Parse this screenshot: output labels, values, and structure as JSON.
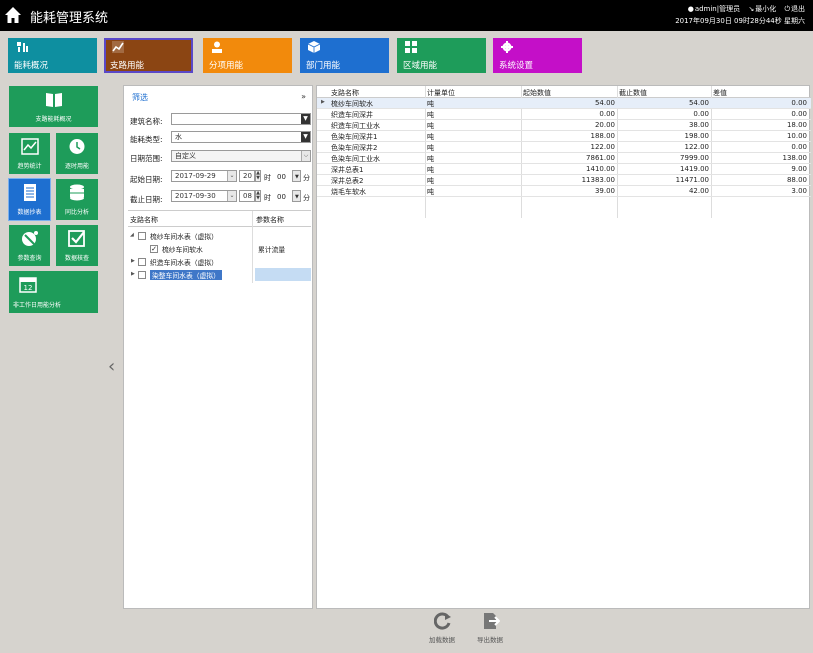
{
  "window": {
    "title": "能耗管理系统"
  },
  "header": {
    "user": "admin|管理员",
    "minimize": "最小化",
    "exit": "退出",
    "datetime": "2017年09月30日 09时28分44秒 星期六"
  },
  "top_nav": [
    {
      "label": "能耗概况",
      "color": "#0e8fa0"
    },
    {
      "label": "支路用能",
      "color": "#8b4513"
    },
    {
      "label": "分项用能",
      "color": "#f28a0c"
    },
    {
      "label": "部门用能",
      "color": "#1e6fd0"
    },
    {
      "label": "区域用能",
      "color": "#1e9c5a"
    },
    {
      "label": "系统设置",
      "color": "#c40fc8"
    }
  ],
  "sidebar": {
    "items": [
      {
        "label": "支路能耗概况"
      },
      {
        "label": "趋势统计"
      },
      {
        "label": "逐时用能"
      },
      {
        "label": "数据抄表"
      },
      {
        "label": "同比分析"
      },
      {
        "label": "参数查询"
      },
      {
        "label": "数据核查"
      },
      {
        "label": "非工作日用能分析"
      }
    ]
  },
  "filter": {
    "title": "筛选",
    "close": "»",
    "building_label": "建筑名称:",
    "building_value": "",
    "energy_label": "能耗类型:",
    "energy_value": "水",
    "range_label": "日期范围:",
    "range_value": "自定义",
    "start_label": "起始日期:",
    "start_date": "2017-09-29",
    "start_hour": "20",
    "end_label": "截止日期:",
    "end_date": "2017-09-30",
    "end_hour": "08",
    "hour_unit": "时",
    "minute_value": "00",
    "minute_unit": "分",
    "tree_col1": "支路名称",
    "tree_col2": "参数名称",
    "tree": [
      {
        "label": "梳纱车间水表（虚拟）",
        "param": ""
      },
      {
        "label": "梳纱车间软水",
        "param": "累计流量"
      },
      {
        "label": "织造车间水表（虚拟）",
        "param": ""
      },
      {
        "label": "染整车间水表（虚拟）",
        "param": ""
      }
    ]
  },
  "grid": {
    "columns": [
      "支路名称",
      "计量单位",
      "起始数值",
      "截止数值",
      "差值"
    ],
    "rows": [
      [
        "梳纱车间软水",
        "吨",
        "54.00",
        "54.00",
        "0.00"
      ],
      [
        "织造车间深井",
        "吨",
        "0.00",
        "0.00",
        "0.00"
      ],
      [
        "织造车间工业水",
        "吨",
        "20.00",
        "38.00",
        "18.00"
      ],
      [
        "色染车间深井1",
        "吨",
        "188.00",
        "198.00",
        "10.00"
      ],
      [
        "色染车间深井2",
        "吨",
        "122.00",
        "122.00",
        "0.00"
      ],
      [
        "色染车间工业水",
        "吨",
        "7861.00",
        "7999.00",
        "138.00"
      ],
      [
        "深井总表1",
        "吨",
        "1410.00",
        "1419.00",
        "9.00"
      ],
      [
        "深井总表2",
        "吨",
        "11383.00",
        "11471.00",
        "88.00"
      ],
      [
        "烧毛车软水",
        "吨",
        "39.00",
        "42.00",
        "3.00"
      ]
    ]
  },
  "bottom": {
    "load_label": "加载数据",
    "export_label": "导出数据"
  }
}
